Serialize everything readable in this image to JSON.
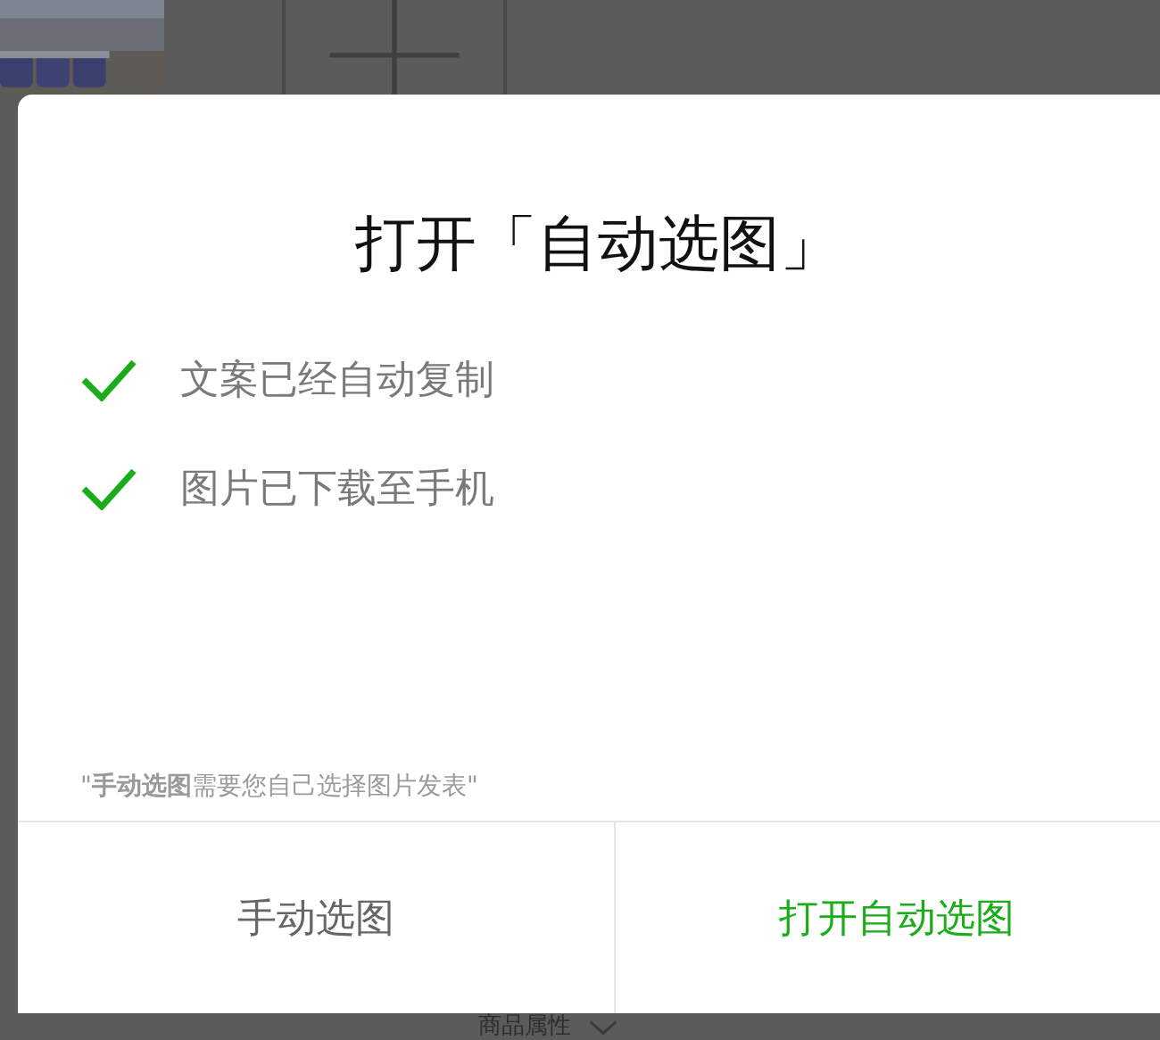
{
  "background": {
    "section_label": "商品属性"
  },
  "dialog": {
    "title": "打开「自动选图」",
    "items": [
      {
        "label": "文案已经自动复制",
        "checked": true
      },
      {
        "label": "图片已下载至手机",
        "checked": true
      }
    ],
    "note": "\"**手动选图**需要您自己选择图片发表\"",
    "buttons": [
      {
        "label": "手动选图",
        "kind": "secondary"
      },
      {
        "label": "打开自动选图",
        "kind": "primary"
      }
    ]
  }
}
